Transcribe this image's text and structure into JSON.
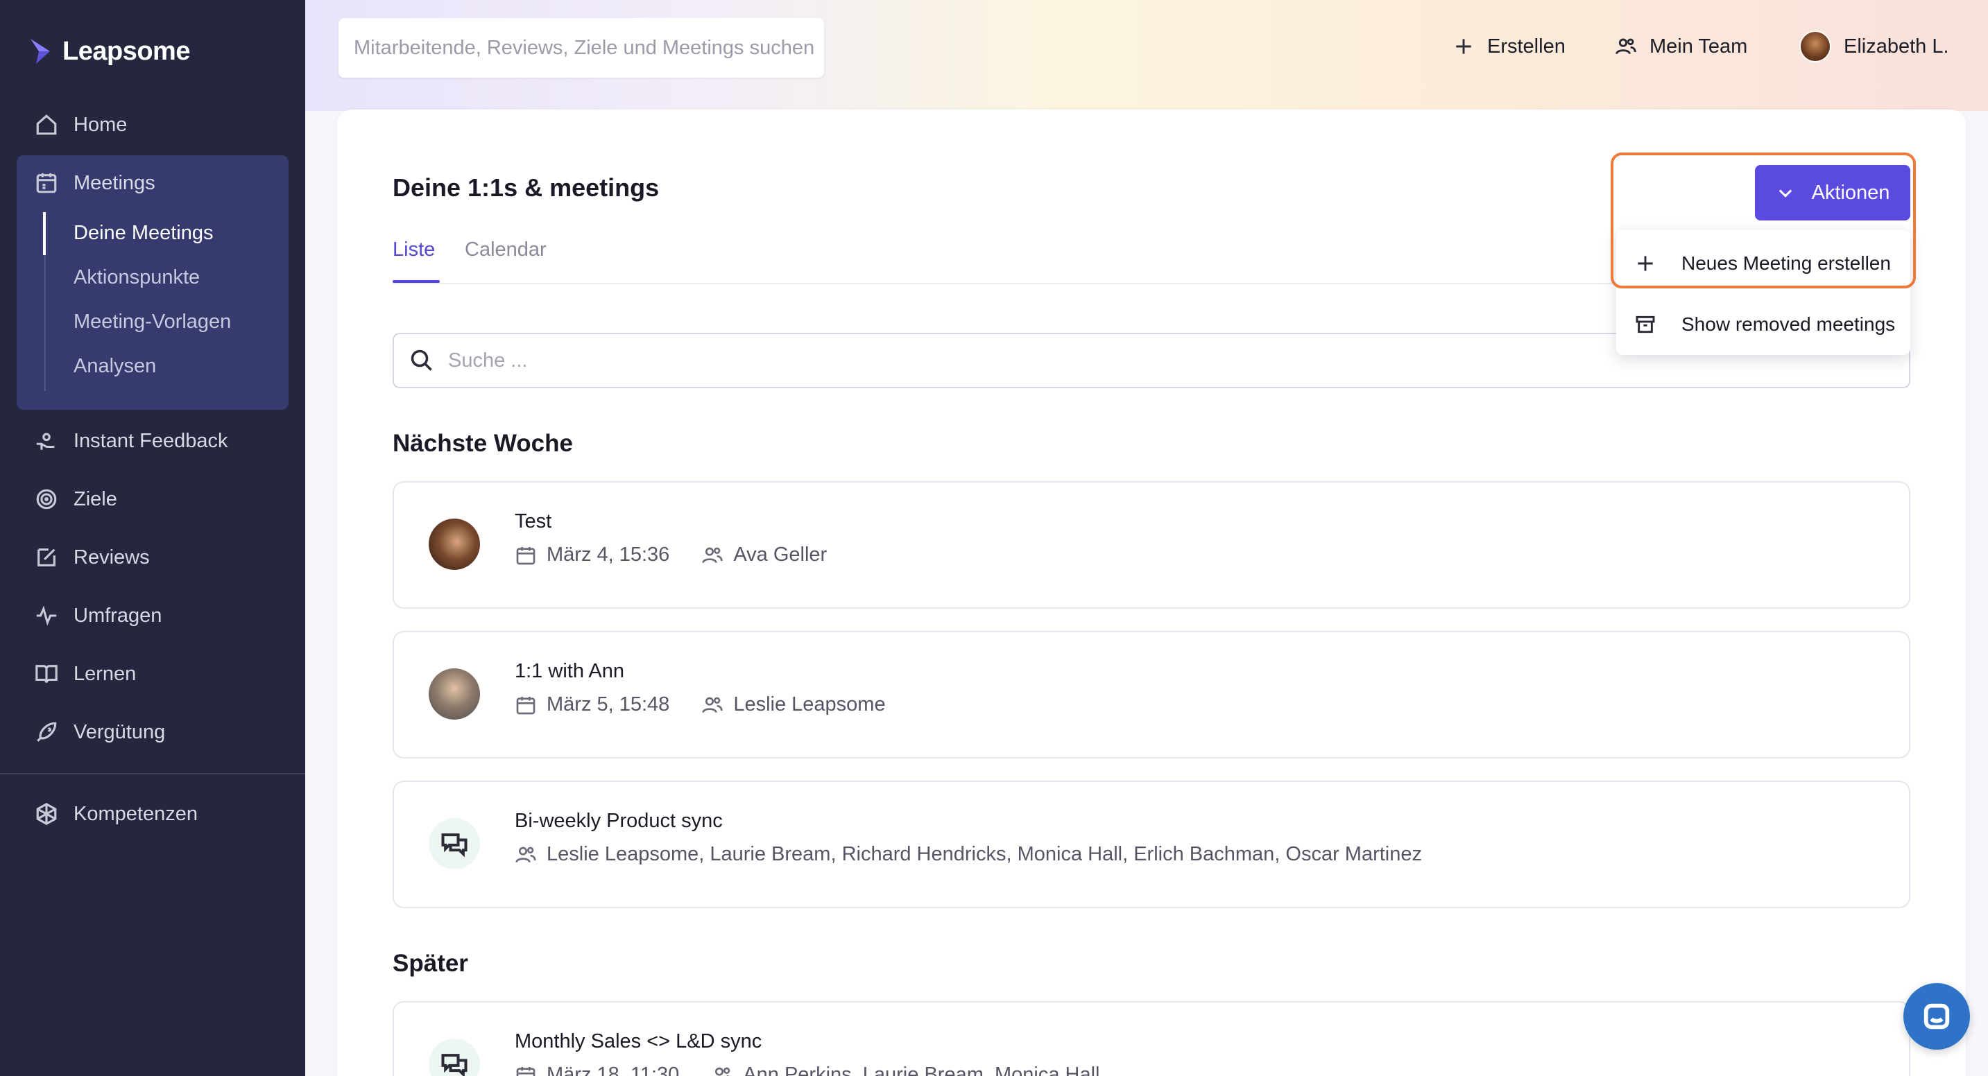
{
  "app": {
    "brand": "Leapsome"
  },
  "topbar": {
    "search_placeholder": "Mitarbeitende, Reviews, Ziele und Meetings suchen",
    "create_label": "Erstellen",
    "team_label": "Mein Team",
    "user_name": "Elizabeth L."
  },
  "sidebar": {
    "items": [
      {
        "label": "Home",
        "icon": "home-icon"
      },
      {
        "label": "Meetings",
        "icon": "meetings-icon"
      },
      {
        "label": "Instant Feedback",
        "icon": "feedback-hand-icon"
      },
      {
        "label": "Ziele",
        "icon": "target-icon"
      },
      {
        "label": "Reviews",
        "icon": "edit-icon"
      },
      {
        "label": "Umfragen",
        "icon": "pulse-icon"
      },
      {
        "label": "Lernen",
        "icon": "book-icon"
      },
      {
        "label": "Vergütung",
        "icon": "rocket-icon"
      },
      {
        "label": "Kompetenzen",
        "icon": "skills-icon"
      }
    ],
    "meetings_sub": [
      {
        "label": "Deine Meetings",
        "active": true
      },
      {
        "label": "Aktionspunkte",
        "active": false
      },
      {
        "label": "Meeting-Vorlagen",
        "active": false
      },
      {
        "label": "Analysen",
        "active": false
      }
    ]
  },
  "main": {
    "title": "Deine 1:1s & meetings",
    "tabs": [
      "Liste",
      "Calendar"
    ],
    "active_tab": "Liste",
    "search_placeholder": "Suche ...",
    "actions": {
      "button_label": "Aktionen",
      "menu": [
        "Neues Meeting erstellen",
        "Show removed meetings"
      ]
    },
    "sections": [
      {
        "title": "Nächste Woche",
        "meetings": [
          {
            "title": "Test",
            "date": "März 4, 15:36",
            "participants": "Ava Geller"
          },
          {
            "title": "1:1 with Ann",
            "date": "März 5, 15:48",
            "participants": "Leslie Leapsome"
          },
          {
            "title": "Bi-weekly Product sync",
            "date": "",
            "participants": "Leslie Leapsome, Laurie Bream, Richard Hendricks, Monica Hall, Erlich Bachman, Oscar Martinez"
          }
        ]
      },
      {
        "title": "Später",
        "meetings": [
          {
            "title": "Monthly Sales <> L&D sync",
            "date": "März 18, 11:30",
            "participants": "Ann Perkins, Laurie Bream, Monica Hall"
          }
        ]
      }
    ]
  },
  "colors": {
    "sidebar_bg": "#25273f",
    "sidebar_active_bg": "#363a6e",
    "accent": "#5a4adf",
    "highlight": "#ec7a3b",
    "chat_bubble": "#2e73c8"
  }
}
